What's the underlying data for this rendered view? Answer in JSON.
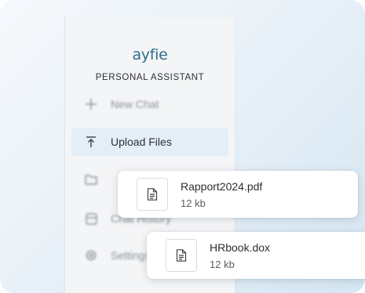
{
  "brand": {
    "logo_text": "ayfie",
    "subtitle": "PERSONAL ASSISTANT"
  },
  "nav": {
    "new_chat": "New Chat",
    "upload_files": "Upload Files",
    "chat_history": "Chat History",
    "settings": "Settings"
  },
  "files": [
    {
      "name": "Rapport2024.pdf",
      "size": "12 kb",
      "icon": "document-icon"
    },
    {
      "name": "HRbook.dox",
      "size": "12 kb",
      "icon": "document-icon"
    }
  ],
  "colors": {
    "brand": "#2f6d8a",
    "active_item": "#e4eef6"
  }
}
